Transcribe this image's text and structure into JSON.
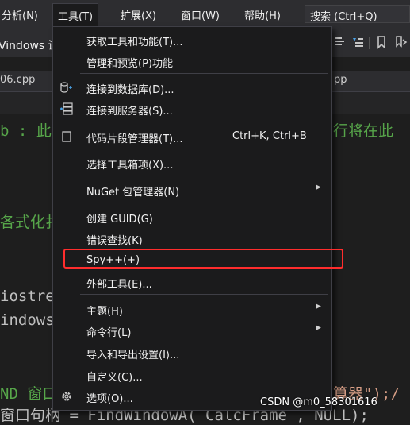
{
  "menubar": {
    "analysis": "分析(N)",
    "tools": "工具(T)",
    "extensions": "扩展(X)",
    "window": "窗口(W)",
    "help": "帮助(H)",
    "search": "搜索 (Ctrl+Q)"
  },
  "toolbar": {
    "partial_text": "Vindows 调"
  },
  "tabs": {
    "left": "06.cpp",
    "right": "pp"
  },
  "code": {
    "line1_left": "b : 此",
    "line1_right": "行将在此",
    "line2": "各式化扌",
    "line3": "iostre",
    "line4": "indows",
    "line5_left": "ND 窗口",
    "line5_right": "算器\");/",
    "line6": "窗口句柄 = FindWindowA( CalcFrame , NULL);"
  },
  "menu": {
    "items": [
      {
        "label": "获取工具和功能(T)...",
        "icon": "",
        "shortcut": "",
        "submenu": false
      },
      {
        "label": "管理和预览(P)功能",
        "icon": "",
        "shortcut": "",
        "submenu": false
      },
      {
        "label": "连接到数据库(D)...",
        "icon": "database-connect-icon",
        "shortcut": "",
        "submenu": false
      },
      {
        "label": "连接到服务器(S)...",
        "icon": "server-connect-icon",
        "shortcut": "",
        "submenu": false
      },
      {
        "label": "代码片段管理器(T)...",
        "icon": "code-snippet-icon",
        "shortcut": "Ctrl+K, Ctrl+B",
        "submenu": false
      },
      {
        "label": "选择工具箱项(X)...",
        "icon": "",
        "shortcut": "",
        "submenu": false
      },
      {
        "label": "NuGet 包管理器(N)",
        "icon": "",
        "shortcut": "",
        "submenu": true
      },
      {
        "label": "创建 GUID(G)",
        "icon": "",
        "shortcut": "",
        "submenu": false
      },
      {
        "label": "错误查找(K)",
        "icon": "",
        "shortcut": "",
        "submenu": false
      },
      {
        "label": "Spy++(+)",
        "icon": "",
        "shortcut": "",
        "submenu": false
      },
      {
        "label": "外部工具(E)...",
        "icon": "",
        "shortcut": "",
        "submenu": false
      },
      {
        "label": "主题(H)",
        "icon": "",
        "shortcut": "",
        "submenu": true
      },
      {
        "label": "命令行(L)",
        "icon": "",
        "shortcut": "",
        "submenu": true
      },
      {
        "label": "导入和导出设置(I)...",
        "icon": "",
        "shortcut": "",
        "submenu": false
      },
      {
        "label": "自定义(C)...",
        "icon": "",
        "shortcut": "",
        "submenu": false
      },
      {
        "label": "选项(O)...",
        "icon": "gear-icon",
        "shortcut": "",
        "submenu": false
      }
    ],
    "highlighted": "Spy++(+)"
  },
  "watermark": "CSDN @m0_58301616",
  "colors": {
    "highlight": "#ff2d2d",
    "menu_bg": "#1b1b1c",
    "code_comment": "#57a64a"
  }
}
